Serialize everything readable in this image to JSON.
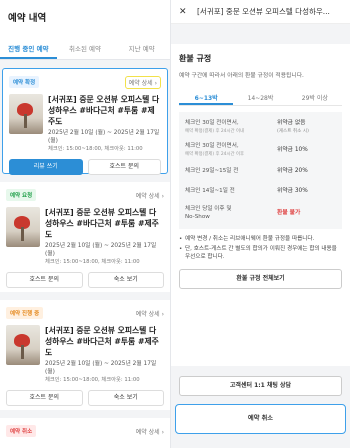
{
  "left": {
    "header_title": "예약 내역",
    "tabs": [
      "진행 중인 예약",
      "취소된 예약",
      "지난 예약"
    ],
    "cards": [
      {
        "badge": "예약 확정",
        "detail": "예약 상세",
        "title": "[서귀포] 중문 오션뷰 오피스텔 다성하우스 #바다근처 #투룸 #제주도",
        "date": "2025년 2월 10일 (월) ~ 2025년 2월 17일 (월)",
        "time": "체크인: 15:00~18:00, 체크아웃: 11:00",
        "buttons": [
          "리뷰 쓰기",
          "호스트 문의"
        ]
      },
      {
        "badge": "예약 요청",
        "detail": "예약 상세",
        "title": "[서귀포] 중문 오션뷰 오피스텔 다성하우스 #바다근처 #투룸 #제주도",
        "date": "2025년 2월 10일 (월) ~ 2025년 2월 17일 (월)",
        "time": "체크인: 15:00~18:00, 체크아웃: 11:00",
        "buttons": [
          "호스트 문의",
          "숙소 보기"
        ]
      },
      {
        "badge": "예약 진행 중",
        "detail": "예약 상세",
        "title": "[서귀포] 중문 오션뷰 오피스텔 다성하우스 #바다근처 #투룸 #제주도",
        "date": "2025년 2월 10일 (월) ~ 2025년 2월 17일 (월)",
        "time": "체크인: 15:00~18:00, 체크아웃: 11:00",
        "buttons": [
          "호스트 문의",
          "숙소 보기"
        ]
      },
      {
        "badge": "예약 취소",
        "detail": "예약 상세"
      }
    ]
  },
  "right": {
    "header_title": "[서귀포] 중문 오션뷰 오피스텔 다성하우...",
    "section_title": "환불 규정",
    "section_sub": "예약 구간에 따라서 아래의 환불 규정이 적용됩니다.",
    "tabs": [
      "6~13박",
      "14~28박",
      "29박 이상"
    ],
    "rows": [
      {
        "left": "체크인 30일 전이면서,",
        "left_sub": "예약 확정(결제) 후 24시간 이내",
        "right": "위약금 없음",
        "right_sub": "(게스트 취소 시)"
      },
      {
        "left": "체크인 30일 전이면서,",
        "left_sub": "예약 확정(결제) 후 24시간 이후",
        "right": "위약금 10%",
        "right_sub": ""
      },
      {
        "left": "체크인 29일~15일 전",
        "left_sub": "",
        "right": "위약금 20%",
        "right_sub": ""
      },
      {
        "left": "체크인 14일~1일 전",
        "left_sub": "",
        "right": "위약금 30%",
        "right_sub": ""
      },
      {
        "left": "체크인 당일 이후 및",
        "left2": "No-Show",
        "left_sub": "",
        "right": "환불 불가",
        "right_sub": ""
      }
    ],
    "notes": [
      "예약 변경 / 취소는 리브애니웨어 환불 규정을 따릅니다.",
      "단, 호스트-게스트 간 별도의 합의가 이뤄진 경우에는 합의 내용을 우선으로 합니다."
    ],
    "full_button": "환불 규정 전체보기",
    "cs_button": "고객센터 1:1 채팅 상담",
    "cancel_button": "예약 취소"
  }
}
